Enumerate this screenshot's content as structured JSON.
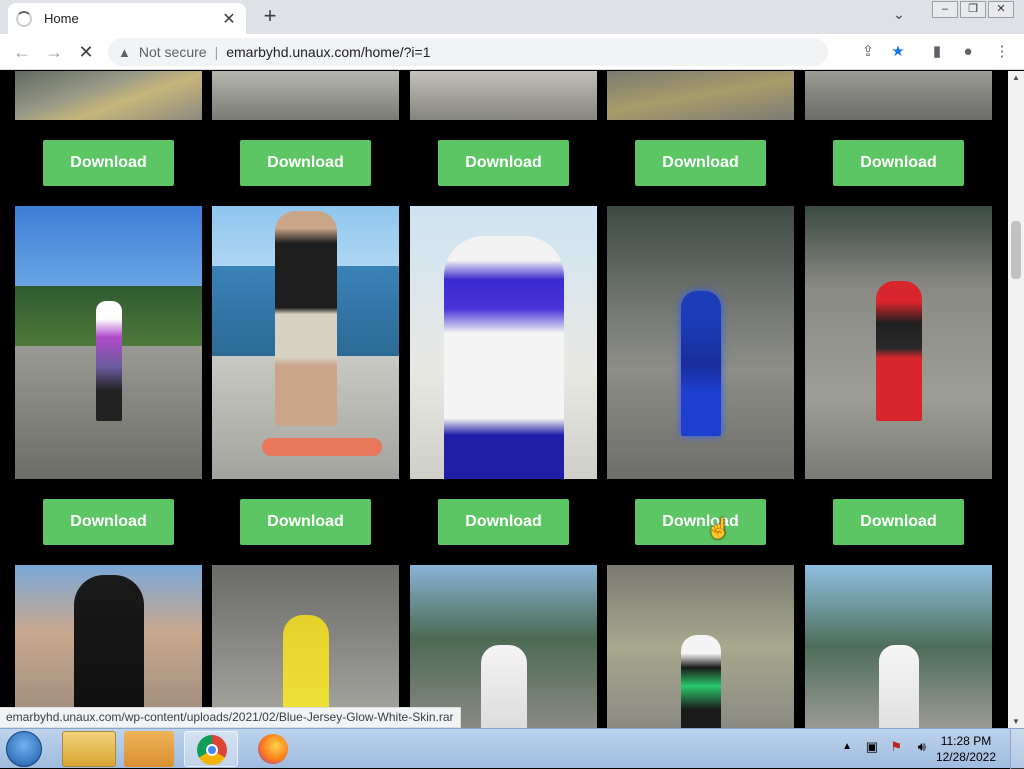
{
  "browser": {
    "tab_title": "Home",
    "security_label": "Not secure",
    "url": "emarbyhd.unaux.com/home/?i=1",
    "status_url": "emarbyhd.unaux.com/wp-content/uploads/2021/02/Blue-Jersey-Glow-White-Skin.rar"
  },
  "page": {
    "download_label": "Download"
  },
  "taskbar": {
    "time": "11:28 PM",
    "date": "12/28/2022"
  },
  "colors": {
    "download_button": "#5cc564",
    "page_background": "#000000"
  }
}
